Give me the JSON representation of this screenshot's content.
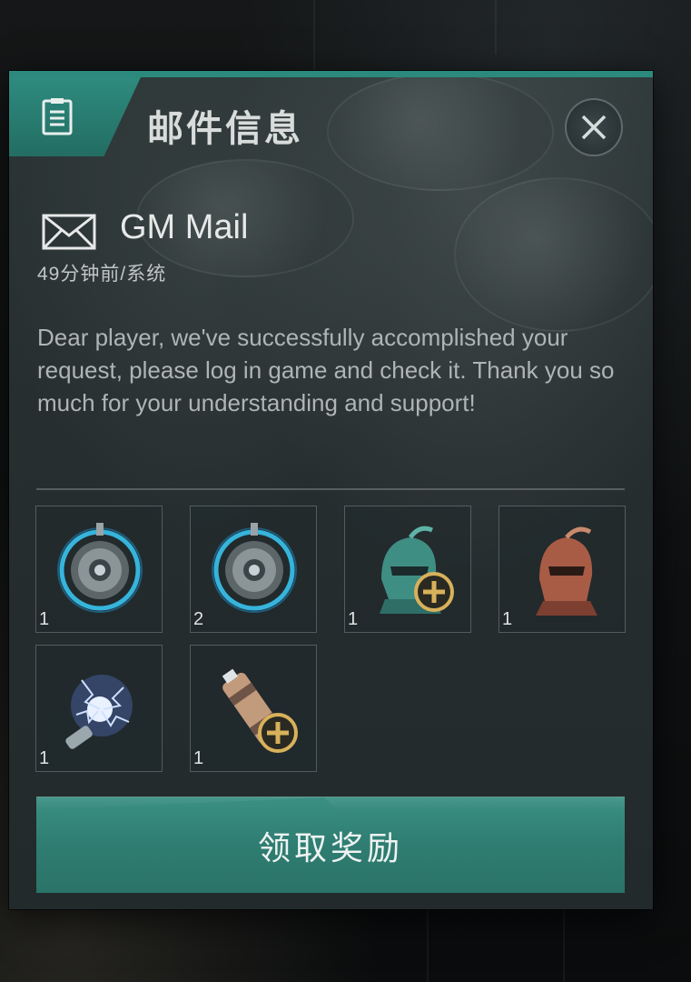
{
  "dialog": {
    "title": "邮件信息",
    "close_icon": "close-icon",
    "header_icon": "document-icon"
  },
  "mail": {
    "icon": "envelope-icon",
    "sender": "GM Mail",
    "meta": "49分钟前/系统",
    "body": "Dear player, we've successfully accomplished your request, please log in game and check it. Thank you so much for your understanding and support!"
  },
  "rewards": [
    {
      "icon": "blue-core-module-icon",
      "qty": "1"
    },
    {
      "icon": "blue-core-module-icon",
      "qty": "2"
    },
    {
      "icon": "green-helmet-plus-icon",
      "qty": "1"
    },
    {
      "icon": "copper-helmet-icon",
      "qty": "1"
    },
    {
      "icon": "lightning-energy-icon",
      "qty": "1"
    },
    {
      "icon": "battery-plus-icon",
      "qty": "1"
    }
  ],
  "claim_button": {
    "label": "领取奖励"
  },
  "colors": {
    "accent": "#2b8a7d",
    "panel": "#283032",
    "text": "#aeb5b4"
  }
}
